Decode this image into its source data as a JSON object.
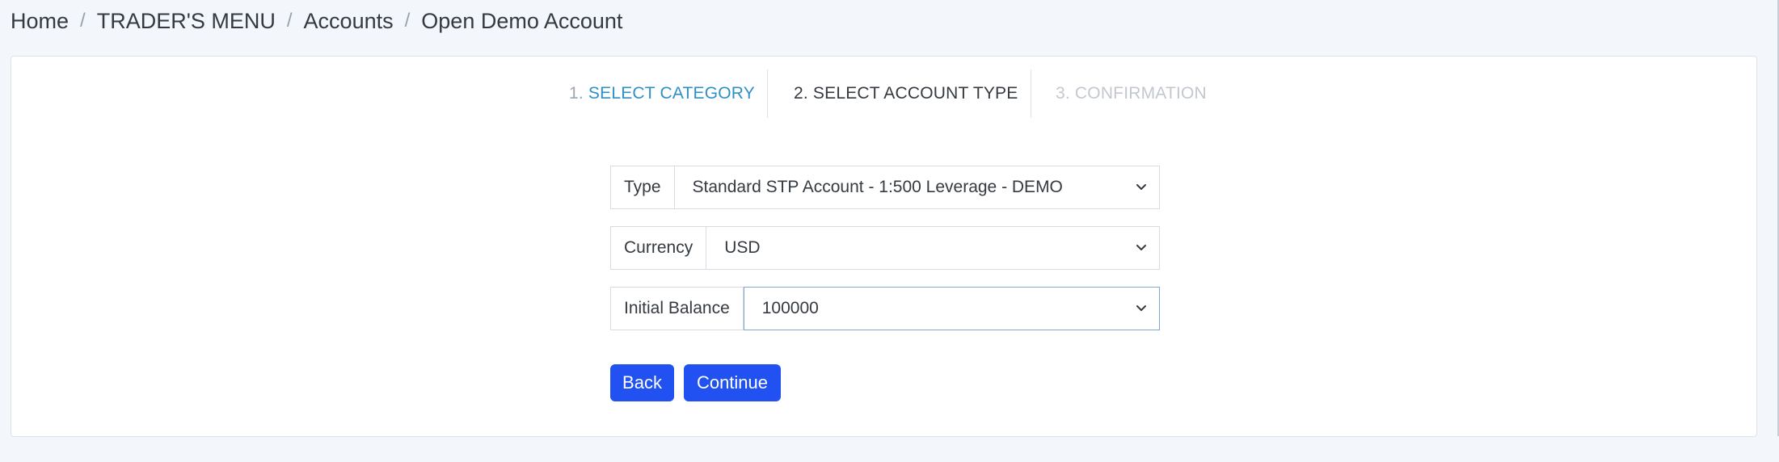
{
  "breadcrumb": {
    "items": [
      "Home",
      "TRADER'S MENU",
      "Accounts",
      "Open Demo Account"
    ],
    "separator": "/"
  },
  "stepper": {
    "steps": [
      {
        "number": "1.",
        "label": "SELECT CATEGORY",
        "state": "completed"
      },
      {
        "number": "2.",
        "label": "SELECT ACCOUNT TYPE",
        "state": "active"
      },
      {
        "number": "3.",
        "label": "CONFIRMATION",
        "state": "disabled"
      }
    ]
  },
  "form": {
    "type": {
      "label": "Type",
      "value": "Standard STP Account - 1:500 Leverage - DEMO"
    },
    "currency": {
      "label": "Currency",
      "value": "USD"
    },
    "initial_balance": {
      "label": "Initial Balance",
      "value": "100000"
    }
  },
  "buttons": {
    "back": "Back",
    "continue": "Continue"
  },
  "colors": {
    "page_background": "#f3f6fb",
    "primary_button": "#2251f2",
    "step_completed_link": "#2f8fc7",
    "step_disabled": "#c3c8cf",
    "focus_border": "#7fa8d9"
  },
  "icons": {
    "select_caret": "chevron-down-icon"
  }
}
